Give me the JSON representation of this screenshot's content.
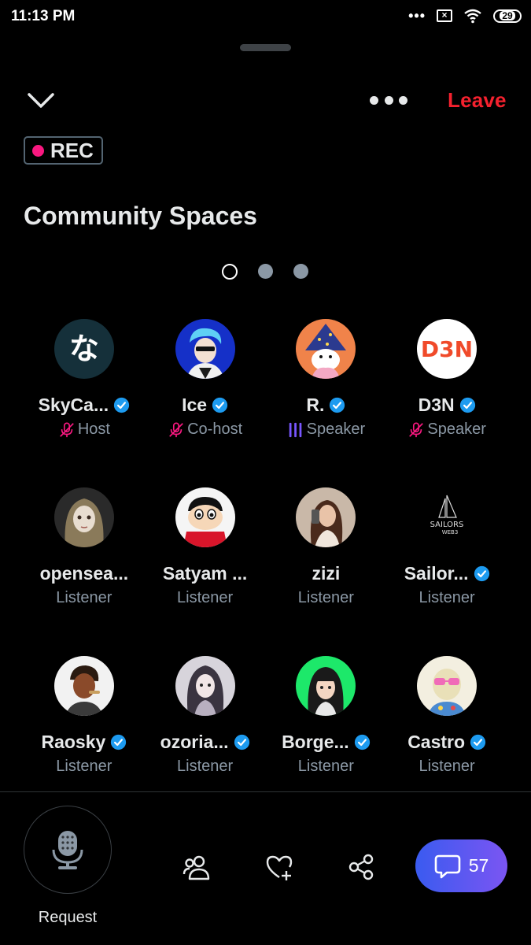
{
  "status_bar": {
    "time": "11:13 PM",
    "battery": "29",
    "more_dots": "•••",
    "sim_icon": "sim-off-icon",
    "wifi_icon": "wifi-icon"
  },
  "header": {
    "leave_label": "Leave",
    "collapse_icon": "chevron-down-icon",
    "more_icon": "more-horizontal-icon"
  },
  "recording": {
    "label": "REC",
    "dot_color": "#f91880"
  },
  "space": {
    "title": "Community Spaces"
  },
  "pager": {
    "pages": 3,
    "active_index": 0
  },
  "members": [
    {
      "name": "SkyCa...",
      "verified": true,
      "role": "Host",
      "role_icon": "mic-off-icon"
    },
    {
      "name": "Ice",
      "verified": true,
      "role": "Co-host",
      "role_icon": "mic-off-icon"
    },
    {
      "name": "R.",
      "verified": true,
      "role": "Speaker",
      "role_icon": "speaking-bars-icon"
    },
    {
      "name": "D3N",
      "verified": true,
      "role": "Speaker",
      "role_icon": "mic-off-icon"
    },
    {
      "name": "opensea...",
      "verified": false,
      "role": "Listener"
    },
    {
      "name": "Satyam ...",
      "verified": false,
      "role": "Listener"
    },
    {
      "name": "zizi",
      "verified": false,
      "role": "Listener"
    },
    {
      "name": "Sailor...",
      "verified": true,
      "role": "Listener"
    },
    {
      "name": "Raosky",
      "verified": true,
      "role": "Listener"
    },
    {
      "name": "ozoria...",
      "verified": true,
      "role": "Listener"
    },
    {
      "name": "Borge...",
      "verified": true,
      "role": "Listener"
    },
    {
      "name": "Castro",
      "verified": true,
      "role": "Listener"
    }
  ],
  "avatar_text": {
    "skycastle": "な",
    "d3n": "D3N",
    "sailors": "SAILORS",
    "sailors_sub": "WEB3"
  },
  "footer": {
    "request_label": "Request",
    "chat_count": "57",
    "icons": [
      "microphone-icon",
      "people-icon",
      "heart-plus-icon",
      "share-icon",
      "chat-bubble-icon"
    ]
  },
  "colors": {
    "accent_red": "#f4212e",
    "verified_blue": "#1d9bf0",
    "muted": "#8b98a5",
    "speaker_purple": "#7856ff",
    "muted_pink": "#f91880",
    "chat_gradient_start": "#3a5bf0",
    "chat_gradient_end": "#7b55f2"
  }
}
